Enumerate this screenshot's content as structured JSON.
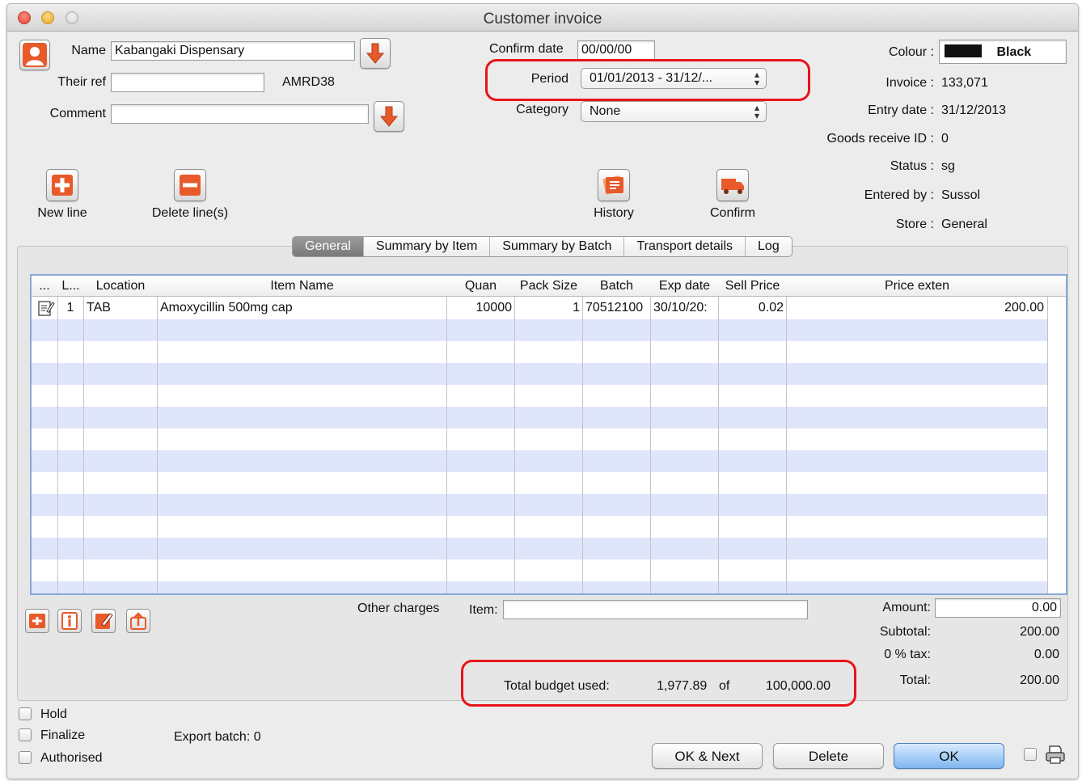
{
  "window": {
    "title": "Customer invoice"
  },
  "header": {
    "name_label": "Name",
    "name_value": "Kabangaki Dispensary",
    "their_ref_label": "Their ref",
    "their_ref_value": "",
    "code": "AMRD38",
    "comment_label": "Comment",
    "comment_value": "",
    "confirm_date_label": "Confirm date",
    "confirm_date_value": "00/00/00",
    "period_label": "Period",
    "period_value": "01/01/2013 - 31/12/...",
    "category_label": "Category",
    "category_value": "None"
  },
  "info": {
    "colour_label": "Colour :",
    "colour_value": "Black",
    "colour_swatch": "#111111",
    "invoice_label": "Invoice :",
    "invoice_value": "133,071",
    "entry_date_label": "Entry date :",
    "entry_date_value": "31/12/2013",
    "goods_receive_label": "Goods receive ID :",
    "goods_receive_value": "0",
    "status_label": "Status :",
    "status_value": "sg",
    "entered_by_label": "Entered by :",
    "entered_by_value": "Sussol",
    "store_label": "Store :",
    "store_value": "General"
  },
  "toolbar": {
    "new_line": "New line",
    "delete_lines": "Delete line(s)",
    "history": "History",
    "confirm": "Confirm"
  },
  "tabs": [
    "General",
    "Summary by Item",
    "Summary by Batch",
    "Transport details",
    "Log"
  ],
  "table": {
    "columns": [
      "...",
      "L...",
      "Location",
      "Item Name",
      "Quan",
      "Pack Size",
      "Batch",
      "Exp date",
      "Sell Price",
      "Price exten"
    ],
    "rows": [
      {
        "line": "1",
        "location": "TAB",
        "item": "Amoxycillin 500mg cap",
        "quantity": "10000",
        "pack_size": "1",
        "batch": "70512100",
        "exp_date": "30/10/20:",
        "sell_price": "0.02",
        "price_extension": "200.00"
      }
    ]
  },
  "charges": {
    "other_charges_label": "Other charges",
    "item_label": "Item:",
    "item_value": "",
    "amount_label": "Amount:",
    "amount_value": "0.00",
    "subtotal_label": "Subtotal:",
    "subtotal_value": "200.00",
    "tax_label": "0  % tax:",
    "tax_value": "0.00",
    "total_label": "Total:",
    "total_value": "200.00"
  },
  "budget": {
    "label": "Total budget used:",
    "used": "1,977.89",
    "of": "of",
    "total": "100,000.00"
  },
  "footer": {
    "hold": "Hold",
    "finalize": "Finalize",
    "authorised": "Authorised",
    "export_batch": "Export batch: 0",
    "ok_next": "OK & Next",
    "delete": "Delete",
    "ok": "OK"
  },
  "colors": {
    "highlight": "#e8141c",
    "stripe": "#dfe5fb",
    "icon_orange": "#e85a2a"
  }
}
